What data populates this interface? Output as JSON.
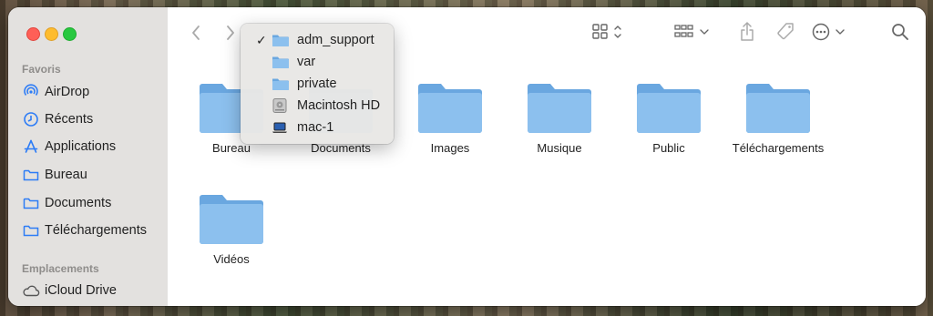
{
  "sidebar": {
    "favorites_heading": "Favoris",
    "favorites": [
      {
        "label": "AirDrop",
        "icon": "airdrop-icon"
      },
      {
        "label": "Récents",
        "icon": "clock-icon"
      },
      {
        "label": "Applications",
        "icon": "applications-icon"
      },
      {
        "label": "Bureau",
        "icon": "folder-icon"
      },
      {
        "label": "Documents",
        "icon": "folder-icon"
      },
      {
        "label": "Téléchargements",
        "icon": "folder-icon"
      }
    ],
    "locations_heading": "Emplacements",
    "locations": [
      {
        "label": "iCloud Drive",
        "icon": "cloud-icon"
      }
    ]
  },
  "path_menu": {
    "items": [
      {
        "label": "adm_support",
        "checked": true,
        "icon": "folder-icon"
      },
      {
        "label": "var",
        "checked": false,
        "icon": "folder-icon"
      },
      {
        "label": "private",
        "checked": false,
        "icon": "folder-icon"
      },
      {
        "label": "Macintosh HD",
        "checked": false,
        "icon": "hard-drive-icon"
      },
      {
        "label": "mac-1",
        "checked": false,
        "icon": "laptop-icon"
      }
    ],
    "check_glyph": "✓"
  },
  "folders": [
    {
      "label": "Bureau"
    },
    {
      "label": "Documents"
    },
    {
      "label": "Images"
    },
    {
      "label": "Musique"
    },
    {
      "label": "Public"
    },
    {
      "label": "Téléchargements"
    },
    {
      "label": "Vidéos"
    }
  ],
  "colors": {
    "accent": "#2d7cf6",
    "folder_body": "#8cc0ee",
    "folder_tab": "#6aa7e0",
    "sidebar_bg": "#e3e1df"
  }
}
